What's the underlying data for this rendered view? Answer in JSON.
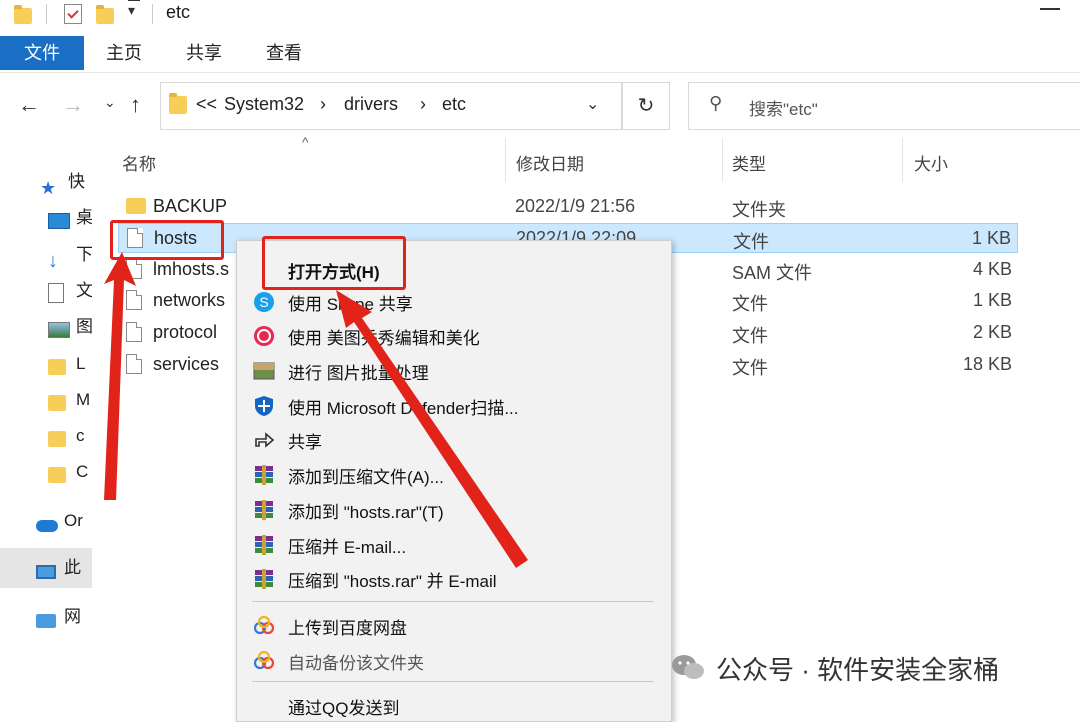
{
  "window": {
    "title": "etc"
  },
  "ribbon": {
    "tabs": [
      "文件",
      "主页",
      "共享",
      "查看"
    ]
  },
  "address": {
    "overflow": "<<",
    "crumbs": [
      "System32",
      "drivers",
      "etc"
    ]
  },
  "search": {
    "placeholder": "搜索\"etc\""
  },
  "left_pane": [
    {
      "label": "快",
      "icon": "star-icon"
    },
    {
      "label": "桌",
      "icon": "desktop-icon"
    },
    {
      "label": "下",
      "icon": "download-icon"
    },
    {
      "label": "文",
      "icon": "document-icon"
    },
    {
      "label": "图",
      "icon": "picture-icon"
    },
    {
      "label": "L",
      "icon": "folder-icon"
    },
    {
      "label": "M",
      "icon": "folder-icon"
    },
    {
      "label": "c",
      "icon": "folder-icon"
    },
    {
      "label": "C",
      "icon": "folder-icon"
    },
    {
      "label": "Or",
      "icon": "cloud-icon"
    },
    {
      "label": "此",
      "icon": "pc-icon"
    },
    {
      "label": "网",
      "icon": "network-icon"
    }
  ],
  "columns": {
    "name": "名称",
    "modified": "修改日期",
    "type": "类型",
    "size": "大小"
  },
  "files": [
    {
      "name": "BACKUP",
      "modified": "2022/1/9 21:56",
      "type": "文件夹",
      "size": "",
      "icon": "folder-icon"
    },
    {
      "name": "hosts",
      "modified": "2022/1/9 22:09",
      "type": "文件",
      "size": "1 KB",
      "icon": "file-icon"
    },
    {
      "name": "lmhosts.s",
      "modified": "",
      "type": "SAM 文件",
      "size": "4 KB",
      "icon": "file-icon"
    },
    {
      "name": "networks",
      "modified": "",
      "type": "文件",
      "size": "1 KB",
      "icon": "file-icon"
    },
    {
      "name": "protocol",
      "modified": "",
      "type": "文件",
      "size": "2 KB",
      "icon": "file-icon"
    },
    {
      "name": "services",
      "modified": "",
      "type": "文件",
      "size": "18 KB",
      "icon": "file-icon"
    }
  ],
  "context_menu": {
    "open_with": "打开方式(H)",
    "items": [
      {
        "label": "使用 Skype 共享",
        "icon": "skype-icon"
      },
      {
        "label": "使用 美图秀秀编辑和美化",
        "icon": "meitu-icon"
      },
      {
        "label": "进行 图片批量处理",
        "icon": "image-batch-icon"
      },
      {
        "label": "使用 Microsoft Defender扫描...",
        "icon": "defender-shield-icon"
      },
      {
        "label": "共享",
        "icon": "share-icon"
      },
      {
        "label": "添加到压缩文件(A)...",
        "icon": "winrar-icon"
      },
      {
        "label": "添加到 \"hosts.rar\"(T)",
        "icon": "winrar-icon"
      },
      {
        "label": "压缩并 E-mail...",
        "icon": "winrar-icon"
      },
      {
        "label": "压缩到 \"hosts.rar\" 并 E-mail",
        "icon": "winrar-icon"
      }
    ],
    "baidu": [
      {
        "label": "上传到百度网盘",
        "icon": "baidu-netdisk-icon"
      },
      {
        "label": "自动备份该文件夹",
        "icon": "baidu-netdisk-icon"
      }
    ],
    "send_qq": "通过QQ发送到"
  },
  "watermark": "公众号 · 软件安装全家桶",
  "colors": {
    "accent": "#1a6fc4",
    "selection": "#cce8ff",
    "annotation": "#e2231a"
  }
}
